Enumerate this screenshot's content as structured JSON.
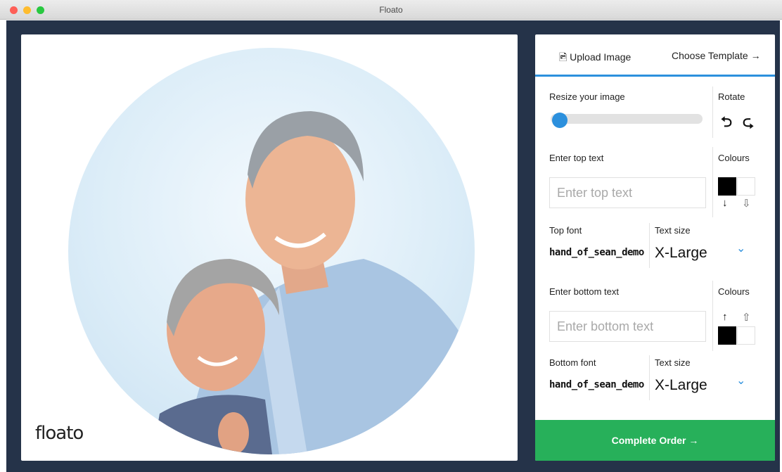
{
  "window": {
    "title": "Floato"
  },
  "preview": {
    "logo": "floato"
  },
  "tabs": {
    "upload_icon": "🖻",
    "upload_label": "Upload Image",
    "template_label": "Choose Template →"
  },
  "resize": {
    "label": "Resize your image",
    "value": 0.04
  },
  "rotate": {
    "label": "Rotate",
    "left_icon": "⮌",
    "right_icon": "⮎"
  },
  "top_text": {
    "label": "Enter top text",
    "value": "",
    "placeholder": "Enter top text"
  },
  "top_colours": {
    "label": "Colours",
    "text_color": "#000000",
    "stroke_color": "#ffffff",
    "arrow_solid": "↓",
    "arrow_hollow": "⇩"
  },
  "top_font": {
    "label": "Top font",
    "value": "hand_of_sean_demo"
  },
  "top_size": {
    "label": "Text size",
    "value": "X-Large",
    "chevron": "⌄"
  },
  "bottom_text": {
    "label": "Enter bottom text",
    "value": "",
    "placeholder": "Enter bottom text"
  },
  "bottom_colours": {
    "label": "Colours",
    "text_color": "#000000",
    "stroke_color": "#ffffff",
    "arrow_solid": "↑",
    "arrow_hollow": "⇧"
  },
  "bottom_font": {
    "label": "Bottom font",
    "value": "hand_of_sean_demo"
  },
  "bottom_size": {
    "label": "Text size",
    "value": "X-Large",
    "chevron": "⌄"
  },
  "complete": {
    "label": "Complete Order →"
  },
  "colors": {
    "accent": "#2c90dd",
    "success": "#27b05a",
    "background": "#253349"
  }
}
